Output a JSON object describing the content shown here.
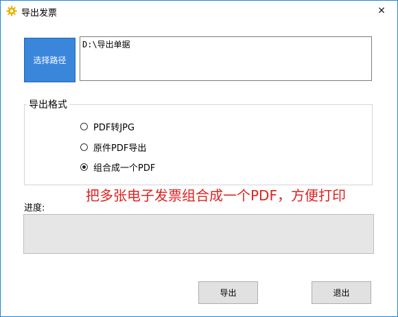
{
  "window": {
    "title": "导出发票",
    "close_glyph": "✕",
    "icon": "gear-icon",
    "icon_color": "#e8b400"
  },
  "path": {
    "button_label": "选择路径",
    "value": "D:\\导出单据"
  },
  "format_group": {
    "title": "导出格式",
    "options": [
      {
        "label": "PDF转JPG",
        "checked": false
      },
      {
        "label": "原件PDF导出",
        "checked": false
      },
      {
        "label": "组合成一个PDF",
        "checked": true
      }
    ]
  },
  "annotation": "把多张电子发票组合成一个PDF，方便打印",
  "annotation_color": "#e02020",
  "progress": {
    "label": "进度:",
    "value": 0
  },
  "buttons": {
    "export": "导出",
    "exit": "退出"
  }
}
